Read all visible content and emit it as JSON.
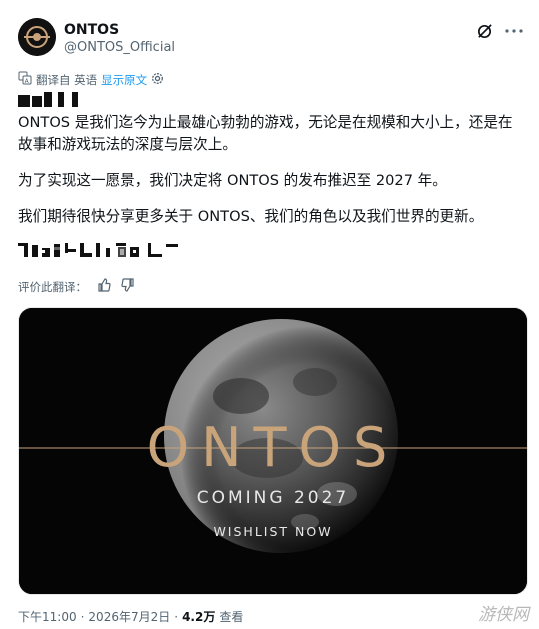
{
  "account": {
    "name": "ONTOS",
    "handle": "@ONTOS_Official"
  },
  "translate": {
    "label": "翻译自 英语",
    "show_original": "显示原文"
  },
  "tweet": {
    "p1": "ONTOS 是我们迄今为止最雄心勃勃的游戏，无论是在规模和大小上，还是在故事和游戏玩法的深度与层次上。",
    "p2": "为了实现这一愿景，我们决定将 ONTOS 的发布推迟至 2027 年。",
    "p3": "我们期待很快分享更多关于 ONTOS、我们的角色以及我们世界的更新。"
  },
  "rate": {
    "label": "评价此翻译："
  },
  "media": {
    "logo_text": "ONTOS",
    "coming": "COMING 2027",
    "wishlist": "WISHLIST NOW",
    "accent": "#c9a47a"
  },
  "footer": {
    "time": "下午11:00",
    "dot1": "·",
    "date": "2026年7月2日",
    "dot2": "·",
    "views": "4.2万",
    "views_label": "查看"
  },
  "watermark": "游侠网"
}
